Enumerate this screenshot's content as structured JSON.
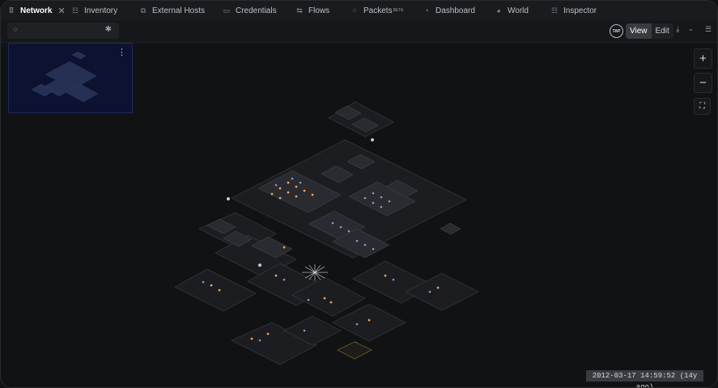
{
  "tabs": [
    {
      "label": "Network",
      "icon": "network-icon",
      "active": true
    },
    {
      "label": "Inventory",
      "icon": "inventory-icon"
    },
    {
      "label": "External Hosts",
      "icon": "external-hosts-icon"
    },
    {
      "label": "Credentials",
      "icon": "credentials-icon"
    },
    {
      "label": "Flows",
      "icon": "flows-icon"
    },
    {
      "label": "Packets",
      "badge": "BETA",
      "icon": "packets-icon"
    },
    {
      "label": "Dashboard",
      "icon": "dashboard-icon"
    },
    {
      "label": "World",
      "icon": "world-icon"
    },
    {
      "label": "Inspector",
      "icon": "inspector-icon"
    }
  ],
  "toolbar": {
    "search_placeholder": "",
    "tap_label": "TAP",
    "view_label": "View",
    "edit_label": "Edit"
  },
  "zoom": {
    "in": "+",
    "out": "−"
  },
  "status": {
    "timestamp": "2012-03-17 14:59:52 (14y ago)"
  },
  "colors": {
    "accent": "#e8a35a",
    "node_blue": "#7f9bd6",
    "minimap_bg": "#0c1230"
  }
}
